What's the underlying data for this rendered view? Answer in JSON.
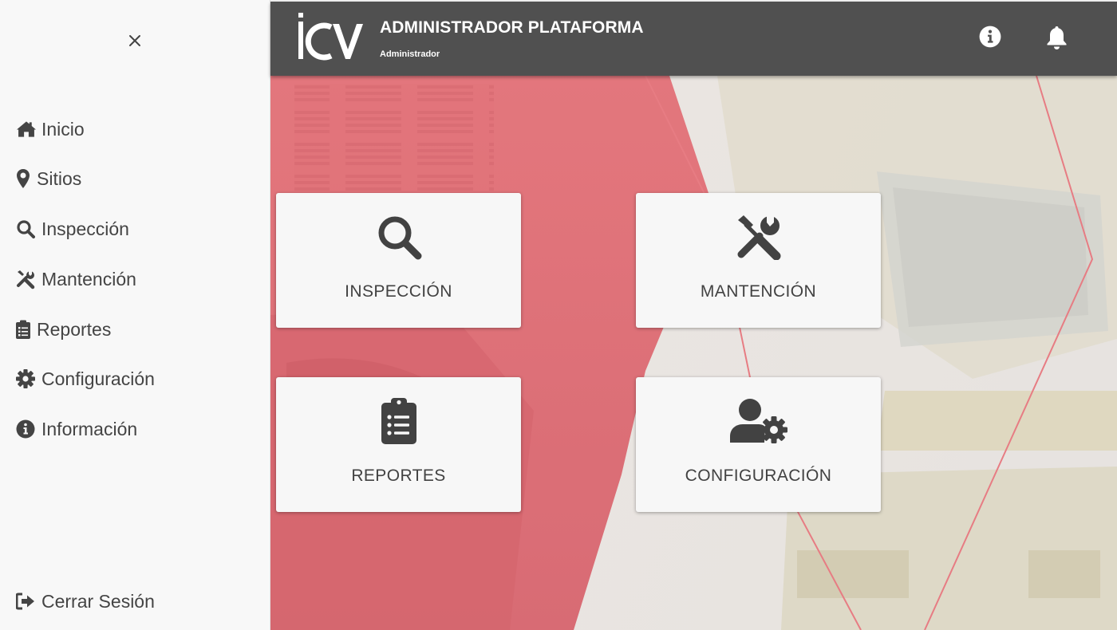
{
  "sidebar": {
    "items": [
      {
        "label": "Inicio",
        "icon": "home-icon"
      },
      {
        "label": "Sitios",
        "icon": "map-marker-icon"
      },
      {
        "label": "Inspección",
        "icon": "search-icon"
      },
      {
        "label": "Mantención",
        "icon": "tools-icon"
      },
      {
        "label": "Reportes",
        "icon": "clipboard-list-icon"
      },
      {
        "label": "Configuración",
        "icon": "gear-icon"
      },
      {
        "label": "Información",
        "icon": "info-circle-icon"
      }
    ],
    "logout_label": "Cerrar Sesión"
  },
  "header": {
    "title": "ADMINISTRADOR PLATAFORMA",
    "role": "Administrador",
    "logo_text": "ICV"
  },
  "cards": [
    {
      "label": "INSPECCIÓN",
      "icon": "search-icon"
    },
    {
      "label": "MANTENCIÓN",
      "icon": "tools-icon"
    },
    {
      "label": "REPORTES",
      "icon": "clipboard-list-icon"
    },
    {
      "label": "CONFIGURACIÓN",
      "icon": "user-cog-icon"
    }
  ],
  "colors": {
    "header_bg": "#505050",
    "sidebar_bg": "#f8f8f8",
    "icon_dark": "#444444",
    "accent_red": "#d9505a"
  }
}
